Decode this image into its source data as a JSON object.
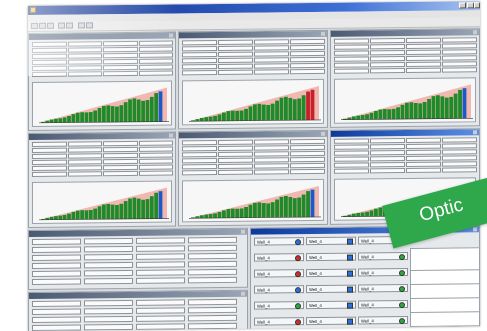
{
  "app": {
    "title": "",
    "menu": [
      "",
      "",
      "",
      ""
    ]
  },
  "panels": [
    {
      "title": "",
      "active": false
    },
    {
      "title": "",
      "active": false
    },
    {
      "title": "",
      "active": false
    },
    {
      "title": "",
      "active": false
    },
    {
      "title": "",
      "active": false
    },
    {
      "title": "",
      "active": true
    }
  ],
  "bottom_panel_titles": [
    "",
    ""
  ],
  "well_items": [
    {
      "label": "Well_4",
      "indicator": "blue",
      "shape": "dot"
    },
    {
      "label": "Well_4",
      "indicator": "red",
      "shape": "dot"
    },
    {
      "label": "Well_4",
      "indicator": "red",
      "shape": "dot"
    },
    {
      "label": "Well_4",
      "indicator": "blue",
      "shape": "dot"
    },
    {
      "label": "Well_4",
      "indicator": "green",
      "shape": "dot"
    },
    {
      "label": "Well_4",
      "indicator": "red",
      "shape": "dot"
    },
    {
      "label": "Well_4",
      "indicator": "blue",
      "shape": "square"
    },
    {
      "label": "Well_4",
      "indicator": "blue",
      "shape": "square"
    },
    {
      "label": "Well_4",
      "indicator": "blue",
      "shape": "square"
    },
    {
      "label": "Well_4",
      "indicator": "blue",
      "shape": "square"
    },
    {
      "label": "Well_4",
      "indicator": "blue",
      "shape": "square"
    },
    {
      "label": "Well_4",
      "indicator": "blue",
      "shape": "square"
    },
    {
      "label": "Well_4",
      "indicator": "blue",
      "shape": "square"
    },
    {
      "label": "Well_4",
      "indicator": "green",
      "shape": "dot"
    },
    {
      "label": "Well_4",
      "indicator": "green",
      "shape": "dot"
    },
    {
      "label": "Well_4",
      "indicator": "green",
      "shape": "dot"
    },
    {
      "label": "Well_4",
      "indicator": "green",
      "shape": "dot"
    },
    {
      "label": "Well_4",
      "indicator": "green",
      "shape": "dot"
    }
  ],
  "right_rows": [
    "",
    "",
    "",
    "",
    ""
  ],
  "banner": {
    "text": "Optic",
    "color": "#2ea84a"
  },
  "colors": {
    "bar_green": "#1f8a2a",
    "bar_red": "#c8202a",
    "bar_blue": "#1a5ac9",
    "area_pink": "#f0b8b0",
    "indicator_blue": "#2c6fe0",
    "indicator_red": "#d42b2b",
    "indicator_green": "#2aa83a"
  }
}
